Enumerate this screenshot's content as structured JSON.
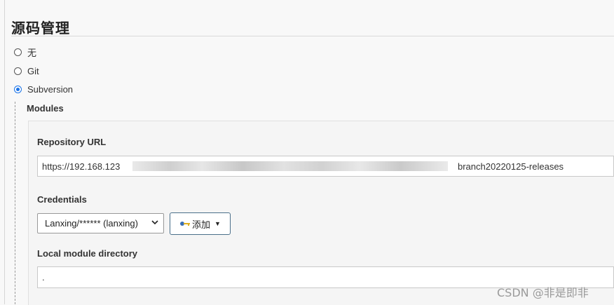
{
  "section": {
    "title": "源码管理"
  },
  "scm_options": [
    {
      "label": "无",
      "checked": false
    },
    {
      "label": "Git",
      "checked": false
    },
    {
      "label": "Subversion",
      "checked": true
    }
  ],
  "modules": {
    "label": "Modules",
    "repository_url": {
      "label": "Repository URL",
      "value_start": "https://192.168.123",
      "value_end": "branch20220125-releases"
    },
    "credentials": {
      "label": "Credentials",
      "selected": "Lanxing/****** (lanxing)",
      "add_button_label": "添加",
      "add_icon": "key-icon"
    },
    "local_module_directory": {
      "label": "Local module directory",
      "value": "."
    }
  },
  "watermark": "CSDN @非是即非",
  "colors": {
    "accent": "#1a73e8",
    "button_border": "#4a6f8a"
  }
}
